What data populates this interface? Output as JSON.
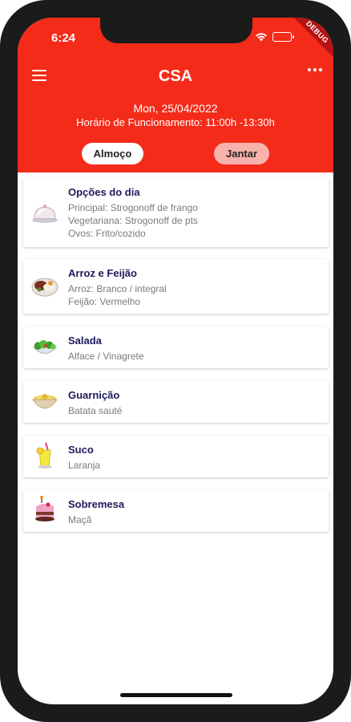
{
  "status_bar": {
    "time": "6:24",
    "debug_label": "DEBUG"
  },
  "header": {
    "title": "CSA",
    "date": "Mon, 25/04/2022",
    "hours": "Horário de Funcionamento: 11:00h -13:30h",
    "background_color": "#f52b1a"
  },
  "tabs": [
    {
      "label": "Almoço",
      "selected": true
    },
    {
      "label": "Jantar",
      "selected": false
    }
  ],
  "menu_items": [
    {
      "icon": "cloche-icon",
      "title": "Opções do dia",
      "lines": [
        "Principal: Strogonoff de frango",
        "Vegetariana: Strogonoff de pts",
        "Ovos: Frito/cozido"
      ]
    },
    {
      "icon": "rice-beans-icon",
      "title": "Arroz e Feijão",
      "lines": [
        "Arroz: Branco / integral",
        "Feijão: Vermelho"
      ]
    },
    {
      "icon": "salad-icon",
      "title": "Salada",
      "lines": [
        "Alface / Vinagrete"
      ]
    },
    {
      "icon": "side-dish-bowl-icon",
      "title": "Guarnição",
      "lines": [
        "Batata sauté"
      ]
    },
    {
      "icon": "juice-icon",
      "title": "Suco",
      "lines": [
        "Laranja"
      ]
    },
    {
      "icon": "cake-icon",
      "title": "Sobremesa",
      "lines": [
        "Maçã"
      ]
    }
  ]
}
